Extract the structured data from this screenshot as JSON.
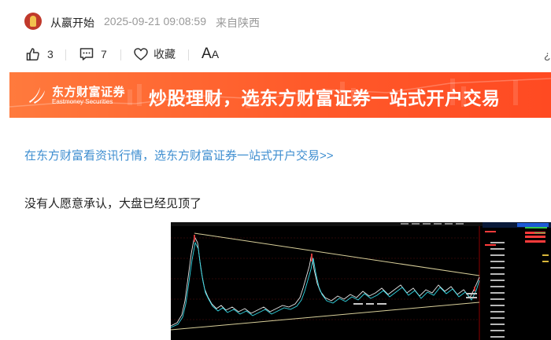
{
  "header": {
    "author": "从嬴开始",
    "timestamp": "2025-09-21 09:08:59",
    "location": "来自陕西"
  },
  "actions": {
    "like_count": "3",
    "comment_count": "7",
    "favorite_label": "收藏",
    "font_big": "A",
    "font_small": "A"
  },
  "banner": {
    "brand_name": "东方财富证券",
    "brand_english": "Eastmoney Securities",
    "slogan": "炒股理财，选东方财富证券一站式开户交易"
  },
  "article": {
    "promo_link": "在东方财富看资讯行情，选东方财富证券一站式开户交易>>",
    "text": "没有人愿意承认，大盘已经见顶了"
  },
  "colors": {
    "link": "#3e8ed0",
    "banner": "#ff5a2a",
    "chart_bg": "#000000"
  }
}
